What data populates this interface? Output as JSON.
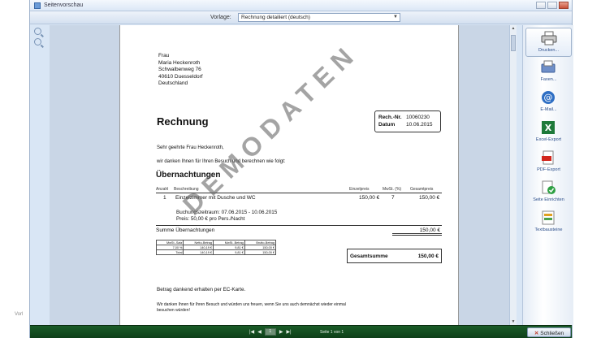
{
  "window": {
    "title": "Seitenvorschau"
  },
  "toolbar": {
    "template_label": "Vorlage:",
    "template_value": "Rechnung detailiert (deutsch)"
  },
  "outside_text": "Vorl",
  "invoice": {
    "address": [
      "Frau",
      "Maria Heckenroth",
      "Schwalbenweg 76",
      "40610 Duesseldorf",
      "Deutschland"
    ],
    "title": "Rechnung",
    "info": {
      "nr_label": "Rech.-Nr.",
      "nr": "10060230",
      "date_label": "Datum",
      "date": "10.06.2015"
    },
    "greeting": "Sehr geehrte Frau Heckenroth,",
    "intro": "wir danken Ihnen für Ihren Besuch und berechnen wie folgt:",
    "section_title": "Übernachtungen",
    "columns": [
      "Anzahl",
      "Beschreibung",
      "Einzelpreis",
      "MwSt. (%)",
      "Gesamtpreis"
    ],
    "row": {
      "qty": "1",
      "desc": "Einzelzimmer mit Dusche und WC",
      "price": "150,00 €",
      "vat": "7",
      "total": "150,00 €"
    },
    "booking_period": "Buchungszeitraum: 07.06.2015 - 10.06.2015",
    "price_note": "Preis: 50,00 € pro Pers./Nacht",
    "subtotal_label": "Summe Übernachtungen",
    "subtotal": "150,00 €",
    "vat_table": {
      "header": [
        "MwSt.-Satz",
        "Netto-Betrag",
        "MwSt.-Betrag",
        "Brutto-Betrag"
      ],
      "rows": [
        [
          "7,00 %",
          "140,19 €",
          "9,81 €",
          "150,00 €"
        ],
        [
          "Total",
          "140,19 €",
          "9,81 €",
          "150,00 €"
        ]
      ]
    },
    "grand_total_label": "Gesamtsumme",
    "grand_total": "150,00 €",
    "payment": "Betrag dankend erhalten per EC-Karte.",
    "closing_1": "Wir danken Ihnen für Ihren Besuch und würden uns freuen, wenn Sie uns auch demnächst wieder einmal",
    "closing_2": "besuchen würden!",
    "watermark": "DEMODATEN"
  },
  "actions": [
    {
      "label": "Drucken...",
      "icon": "printer-icon"
    },
    {
      "label": "Faxen...",
      "icon": "fax-icon"
    },
    {
      "label": "E-Mail...",
      "icon": "email-icon"
    },
    {
      "label": "Excel-Export",
      "icon": "excel-icon"
    },
    {
      "label": "PDF-Export",
      "icon": "pdf-icon"
    },
    {
      "label": "Seite Einrichten",
      "icon": "page-setup-icon"
    },
    {
      "label": "Textbausteine",
      "icon": "text-blocks-icon"
    }
  ],
  "status": {
    "page_number": "1",
    "page_info": "Seite 1 von 1",
    "close_label": "Schließen"
  },
  "colors": {
    "statusbar": "#14502a",
    "accent": "#2a4d8a"
  }
}
